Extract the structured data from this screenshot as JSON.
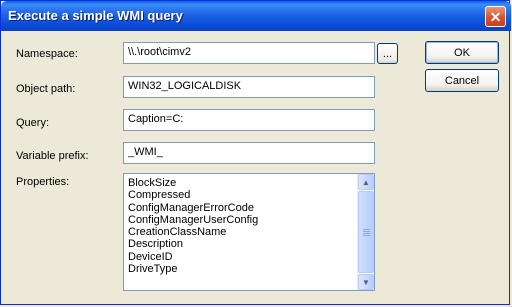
{
  "window": {
    "title": "Execute a simple WMI query",
    "close_glyph": "✕"
  },
  "form": {
    "namespace_label": "Namespace:",
    "namespace_value": "\\\\.\\root\\cimv2",
    "browse_label": "...",
    "object_path_label": "Object path:",
    "object_path_value": "WIN32_LOGICALDISK",
    "query_label": "Query:",
    "query_value": "Caption=C:",
    "variable_prefix_label": "Variable prefix:",
    "variable_prefix_value": "_WMI_",
    "properties_label": "Properties:",
    "properties": [
      "BlockSize",
      "Compressed",
      "ConfigManagerErrorCode",
      "ConfigManagerUserConfig",
      "CreationClassName",
      "Description",
      "DeviceID",
      "DriveType"
    ]
  },
  "buttons": {
    "ok_label": "OK",
    "cancel_label": "Cancel"
  },
  "scroll": {
    "up_glyph": "▲",
    "down_glyph": "▼"
  },
  "colors": {
    "titlebar": "#0A5FE8",
    "dialog_bg": "#ECE9D8",
    "field_border": "#7F9DB9"
  }
}
